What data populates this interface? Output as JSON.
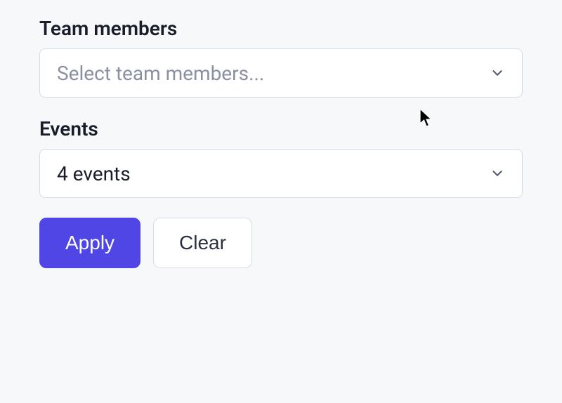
{
  "filters": {
    "team_members": {
      "label": "Team members",
      "placeholder": "Select team members..."
    },
    "events": {
      "label": "Events",
      "value": "4 events"
    }
  },
  "buttons": {
    "apply": "Apply",
    "clear": "Clear"
  }
}
